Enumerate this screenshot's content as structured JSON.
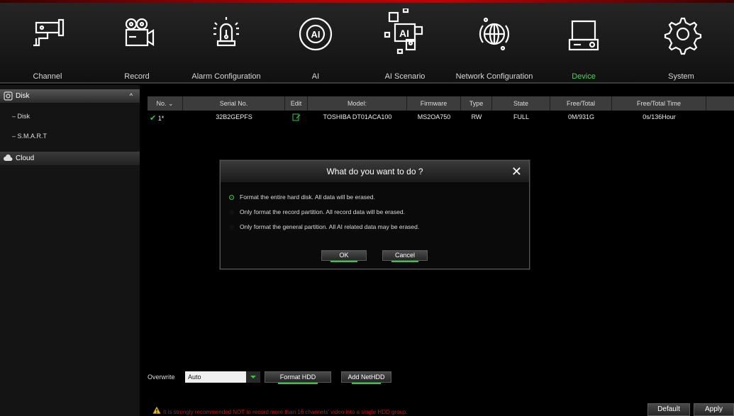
{
  "nav": [
    {
      "label": "Channel",
      "icon": "camera-bullet-icon"
    },
    {
      "label": "Record",
      "icon": "video-camera-icon"
    },
    {
      "label": "Alarm Configuration",
      "icon": "alarm-siren-icon"
    },
    {
      "label": "AI",
      "icon": "ai-brain-icon"
    },
    {
      "label": "AI Scenario",
      "icon": "ai-scenario-icon"
    },
    {
      "label": "Network Configuration",
      "icon": "globe-network-icon"
    },
    {
      "label": "Device",
      "icon": "hdd-device-icon",
      "active": true
    },
    {
      "label": "System",
      "icon": "gear-icon"
    }
  ],
  "sidebar": {
    "disk_header": "Disk",
    "items": [
      "Disk",
      "S.M.A.R.T"
    ],
    "cloud_header": "Cloud"
  },
  "table": {
    "headers": [
      "No.",
      "Serial No.",
      "Edit",
      "Model:",
      "Firmware",
      "Type",
      "State",
      "Free/Total",
      "Free/Total Time"
    ],
    "rows": [
      {
        "no": "1*",
        "serial": "32B2GEPFS",
        "model": "TOSHIBA DT01ACA100",
        "firmware": "MS2OA750",
        "type": "RW",
        "state": "FULL",
        "free_total": "0M/931G",
        "free_total_time": "0s/136Hour"
      }
    ]
  },
  "dialog": {
    "title": "What do you want to do ?",
    "options": [
      "Format the entire hard disk. All data will be erased.",
      "Only format the record partition. All record data will be erased.",
      "Only format the general partition. All AI related data may be erased."
    ],
    "selected": 0,
    "ok": "OK",
    "cancel": "Cancel"
  },
  "bottom": {
    "overwrite_label": "Overwrite",
    "overwrite_value": "Auto",
    "format_hdd": "Format HDD",
    "add_nethdd": "Add NetHDD",
    "warning": "It is strongly recommended NOT to record more than 16 channels' video into a single HDD group.",
    "default": "Default",
    "apply": "Apply"
  },
  "colors": {
    "accent": "#2ecc40",
    "active_label": "#39e04a",
    "warning": "#c41515"
  }
}
